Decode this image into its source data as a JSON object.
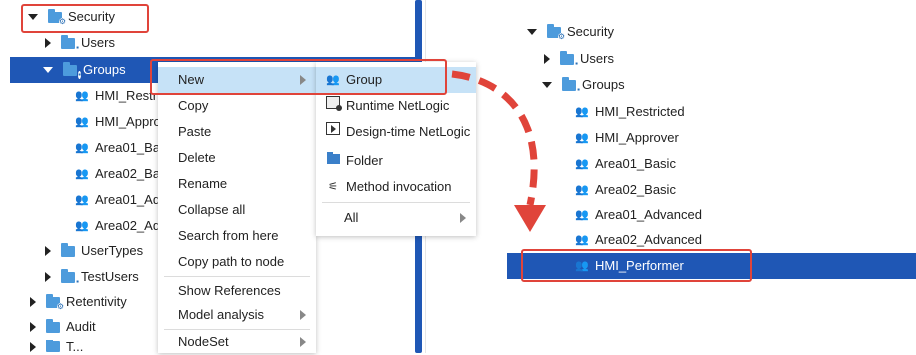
{
  "left_tree": {
    "security": "Security",
    "users": "Users",
    "groups": "Groups",
    "children": [
      "HMI_Restri",
      "HMI_Appro",
      "Area01_Ba",
      "Area02_Ba",
      "Area01_Ad",
      "Area02_Ad"
    ],
    "usertypes": "UserTypes",
    "testusers": "TestUsers",
    "retentivity": "Retentivity",
    "audit": "Audit",
    "truncated": "T..."
  },
  "context_menu": {
    "items": [
      "New",
      "Copy",
      "Paste",
      "Delete",
      "Rename",
      "Collapse all",
      "Search from here",
      "Copy path to node",
      "Show References",
      "Model analysis",
      "NodeSet"
    ]
  },
  "sub_menu": {
    "items": [
      "Group",
      "Runtime NetLogic",
      "Design-time NetLogic",
      "Folder",
      "Method invocation",
      "All"
    ]
  },
  "right_tree": {
    "security": "Security",
    "users": "Users",
    "groups": "Groups",
    "children": [
      "HMI_Restricted",
      "HMI_Approver",
      "Area01_Basic",
      "Area02_Basic",
      "Area01_Advanced",
      "Area02_Advanced",
      "HMI_Performer"
    ]
  },
  "icons": {
    "folder": "folder-icon",
    "user_group": "user-group-icon",
    "expand": "triangle-right-icon",
    "collapse": "triangle-down-icon"
  },
  "colors": {
    "selection": "#1f57b5",
    "menu_highlight": "#c6e2f7",
    "callout_red": "#e0443a",
    "folder_blue": "#4d9bdc"
  }
}
